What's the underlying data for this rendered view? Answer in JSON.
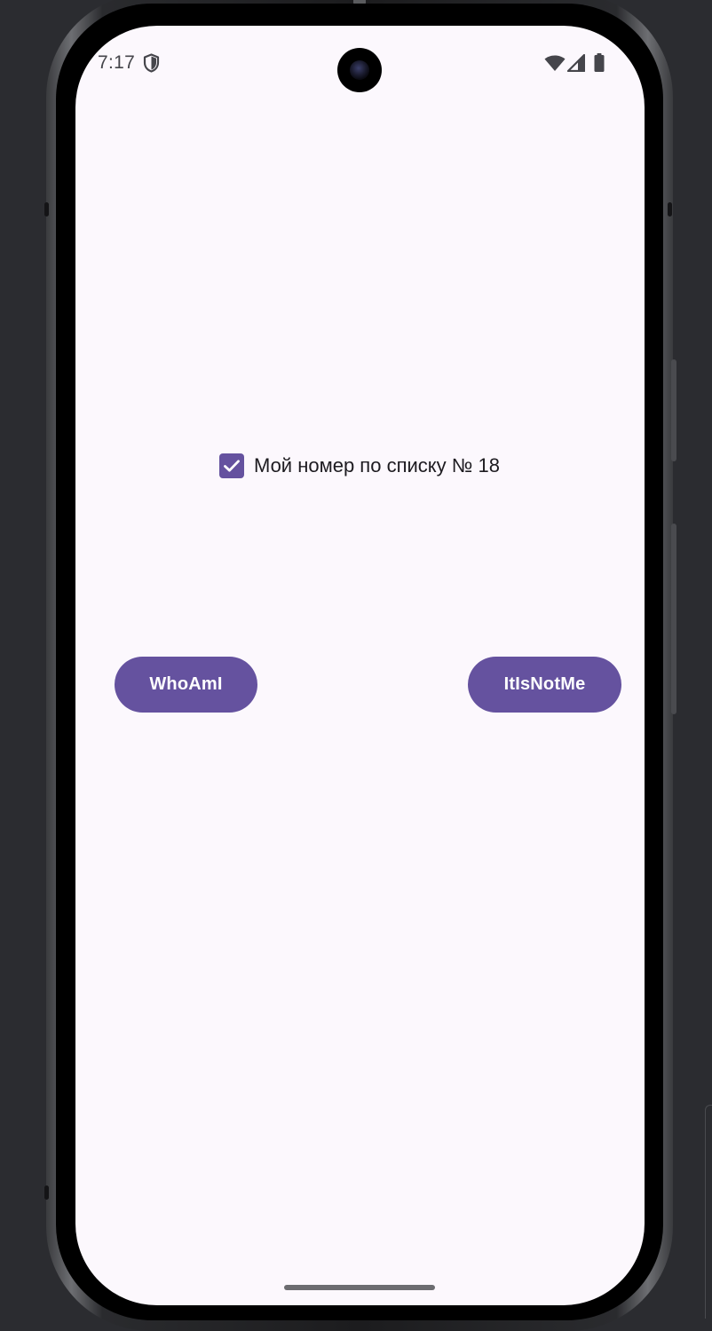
{
  "status_bar": {
    "time": "7:17",
    "icons": [
      "shield-icon",
      "wifi-icon",
      "signal-icon",
      "battery-icon"
    ]
  },
  "checkbox": {
    "checked": true,
    "label": "Мой номер по списку № 18"
  },
  "buttons": {
    "who_am_i": "WhoAmI",
    "it_is_not_me": "ItIsNotMe"
  },
  "colors": {
    "primary": "#65529f",
    "background": "#fcf8fd",
    "text": "#1d1b20"
  }
}
